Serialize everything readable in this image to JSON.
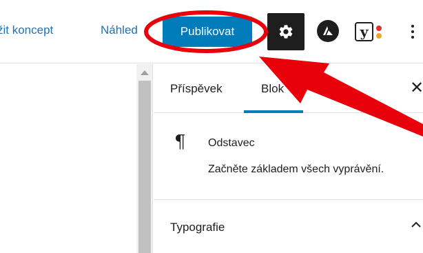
{
  "toolbar": {
    "save_draft_label": "žit koncept",
    "preview_label": "Náhled",
    "publish_label": "Publikovat",
    "yoast_letter": "y",
    "yoast_colors": [
      "#dd3333",
      "#f0a430"
    ]
  },
  "sidebar": {
    "tabs": [
      {
        "label": "Příspěvek",
        "active": false
      },
      {
        "label": "Blok",
        "active": true
      }
    ],
    "close_symbol": "✕",
    "block": {
      "icon": "¶",
      "title": "Odstavec",
      "description": "Začněte základem všech vyprávění."
    },
    "panel": {
      "title": "Typografie",
      "expanded": true
    }
  },
  "colors": {
    "accent": "#007cba",
    "annotation": "#e8000b",
    "dark": "#1e1e1e"
  },
  "icons": {
    "settings": "gear-icon",
    "astra": "astra-logo-icon",
    "yoast": "yoast-seo-icon",
    "more": "vertical-ellipsis-icon",
    "close": "close-icon",
    "block": "paragraph-icon",
    "panel_toggle": "chevron-up-icon"
  }
}
